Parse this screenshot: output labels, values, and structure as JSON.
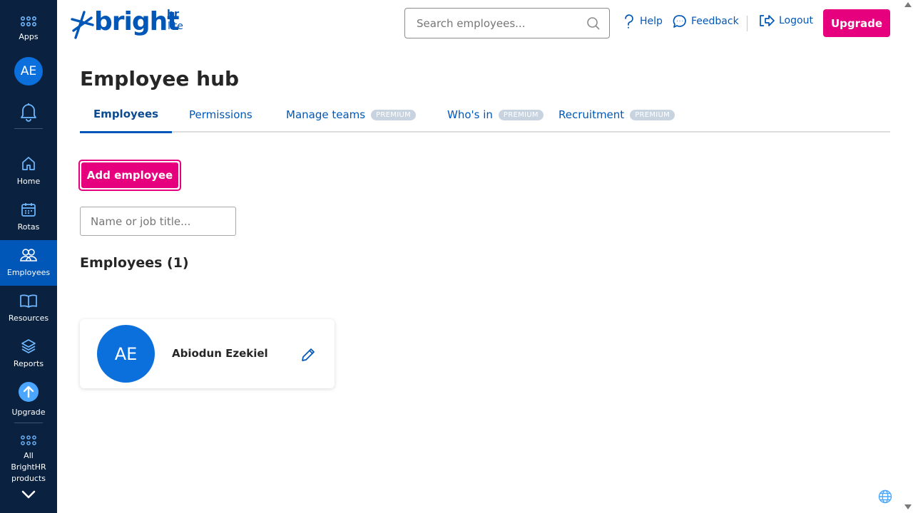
{
  "sidebar": {
    "apps_label": "Apps",
    "avatar_initials": "AE",
    "items": [
      {
        "label": "Home",
        "icon": "home-icon"
      },
      {
        "label": "Rotas",
        "icon": "calendar-icon"
      },
      {
        "label": "Employees",
        "icon": "employees-icon"
      },
      {
        "label": "Resources",
        "icon": "book-icon"
      },
      {
        "label": "Reports",
        "icon": "layers-icon"
      },
      {
        "label": "Upgrade",
        "icon": "upgrade-icon"
      }
    ],
    "all_products_label": "All BrightHR products"
  },
  "header": {
    "logo_text": "bright",
    "logo_hr": "hr",
    "logo_lite": "lite",
    "search_placeholder": "Search employees...",
    "help_label": "Help",
    "feedback_label": "Feedback",
    "logout_label": "Logout",
    "upgrade_label": "Upgrade"
  },
  "page": {
    "title": "Employee hub",
    "tabs": [
      {
        "label": "Employees",
        "badge": ""
      },
      {
        "label": "Permissions",
        "badge": ""
      },
      {
        "label": "Manage teams",
        "badge": "PREMIUM"
      },
      {
        "label": "Who's in",
        "badge": "PREMIUM"
      },
      {
        "label": "Recruitment",
        "badge": "PREMIUM"
      }
    ],
    "add_employee_label": "Add employee",
    "filter_placeholder": "Name or job title...",
    "employees_heading": "Employees (1)",
    "employees": [
      {
        "initials": "AE",
        "name": "Abiodun Ezekiel"
      }
    ]
  },
  "colors": {
    "sidebar_bg": "#0a2240",
    "accent_blue": "#0057b8",
    "brand_pink": "#e6007e",
    "avatar_blue": "#0b6fdc"
  }
}
